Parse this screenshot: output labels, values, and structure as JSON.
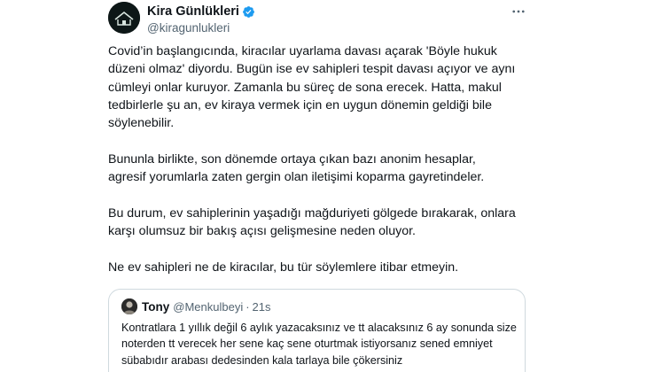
{
  "tweet": {
    "display_name": "Kira Günlükleri",
    "handle": "@kiragunlukleri",
    "verified_icon": "verified-badge-icon",
    "more_icon": "more-options-icon",
    "text": "Covid’in başlangıcında, kiracılar uyarlama davası açarak 'Böyle hukuk\ndüzeni olmaz' diyordu. Bugün ise ev sahipleri tespit davası açıyor ve aynı\ncümleyi onlar kuruyor. Zamanla bu süreç de sona erecek. Hatta, makul\ntedbirlerle şu an, ev kiraya vermek için en uygun dönemin geldiği bile\nsöylenebilir.\n\nBununla birlikte, son dönemde ortaya çıkan bazı anonim hesaplar,\nagresif yorumlarla zaten gergin olan iletişimi koparma gayretindeler.\n\nBu durum, ev sahiplerinin yaşadığı mağduriyeti gölgede bırakarak, onlara\nkarşı olumsuz bir bakış açısı gelişmesine neden oluyor.\n\nNe ev sahipleri ne de kiracılar, bu tür söylemlere itibar etmeyin."
  },
  "quote": {
    "display_name": "Tony",
    "handle": "@Menkulbeyi",
    "separator": "·",
    "time": "21s",
    "text": "Kontratlara 1 yıllık değil 6 aylık yazacaksınız ve tt alacaksınız 6 ay sonunda size\nnoterden tt verecek her sene kaç sene oturtmak istiyorsanız sened emniyet\nsübabıdır arabası dedesinden kala tarlaya bile çökersiniz"
  },
  "colors": {
    "text_primary": "#0f1419",
    "text_secondary": "#536471",
    "verified_blue": "#1d9bf0",
    "border": "#cfd9de"
  }
}
